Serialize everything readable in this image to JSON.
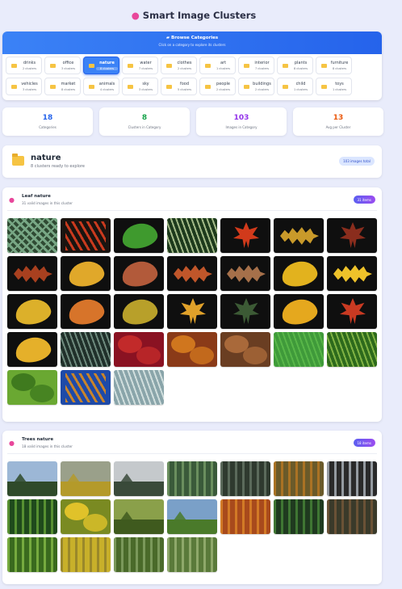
{
  "app": {
    "title": "Smart Image Clusters"
  },
  "browse": {
    "title": "Browse Categories",
    "subtitle": "Click on a category to explore its clusters",
    "row1": [
      {
        "name": "drinks",
        "count": "2 clusters"
      },
      {
        "name": "office",
        "count": "3 clusters"
      },
      {
        "name": "nature",
        "count": "8 clusters",
        "active": true
      },
      {
        "name": "water",
        "count": "7 clusters"
      },
      {
        "name": "clothes",
        "count": "2 clusters"
      },
      {
        "name": "art",
        "count": "1 clusters"
      },
      {
        "name": "interior",
        "count": "7 clusters"
      },
      {
        "name": "plants",
        "count": "8 clusters"
      },
      {
        "name": "furniture",
        "count": "8 clusters"
      }
    ],
    "row2": [
      {
        "name": "vehicles",
        "count": "3 clusters"
      },
      {
        "name": "market",
        "count": "8 clusters"
      },
      {
        "name": "animals",
        "count": "4 clusters"
      },
      {
        "name": "sky",
        "count": "3 clusters"
      },
      {
        "name": "food",
        "count": "5 clusters"
      },
      {
        "name": "people",
        "count": "2 clusters"
      },
      {
        "name": "buildings",
        "count": "2 clusters"
      },
      {
        "name": "child",
        "count": "1 clusters"
      },
      {
        "name": "toys",
        "count": "1 clusters"
      }
    ]
  },
  "stats": [
    {
      "value": "18",
      "label": "Categories",
      "color": "#2563eb"
    },
    {
      "value": "8",
      "label": "Clusters in Category",
      "color": "#16a34a"
    },
    {
      "value": "103",
      "label": "Images in Category",
      "color": "#9333ea"
    },
    {
      "value": "13",
      "label": "Avg per Cluster",
      "color": "#ea580c"
    }
  ],
  "category": {
    "name": "nature",
    "subtitle": "8 clusters ready to explore",
    "badge": "103 images total"
  },
  "clusters": [
    {
      "title": "Leaf nature",
      "subtitle": "31 valid images in this cluster",
      "pill": "31 items",
      "images": [
        {
          "bg": "#2f4a33",
          "fg": "#8bbf9a",
          "kind": "agave"
        },
        {
          "bg": "#1a1410",
          "fg": "#c93a1e",
          "kind": "tropical"
        },
        {
          "bg": "#0f0f0f",
          "fg": "#3f9a2e",
          "kind": "leaf"
        },
        {
          "bg": "#1d3a1c",
          "fg": "#b9cf9a",
          "kind": "stripe"
        },
        {
          "bg": "#0f0f0f",
          "fg": "#d13a1b",
          "kind": "maple"
        },
        {
          "bg": "#0f0f0f",
          "fg": "#c99a2a",
          "kind": "oak"
        },
        {
          "bg": "#0f0f0f",
          "fg": "#8a2d1d",
          "kind": "maple"
        },
        {
          "bg": "#0f0f0f",
          "fg": "#a8401f",
          "kind": "oak"
        },
        {
          "bg": "#0f0f0f",
          "fg": "#e0a82a",
          "kind": "leaf"
        },
        {
          "bg": "#0f0f0f",
          "fg": "#b25a3a",
          "kind": "leaf"
        },
        {
          "bg": "#0f0f0f",
          "fg": "#c0562a",
          "kind": "oak"
        },
        {
          "bg": "#0f0f0f",
          "fg": "#a6704a",
          "kind": "oak"
        },
        {
          "bg": "#0f0f0f",
          "fg": "#e2b21e",
          "kind": "leaf"
        },
        {
          "bg": "#0f0f0f",
          "fg": "#eec22a",
          "kind": "oak"
        },
        {
          "bg": "#0f0f0f",
          "fg": "#dcb02a",
          "kind": "leaf"
        },
        {
          "bg": "#0f0f0f",
          "fg": "#d7742a",
          "kind": "leaf"
        },
        {
          "bg": "#0f0f0f",
          "fg": "#b8a02a",
          "kind": "leaf"
        },
        {
          "bg": "#0f0f0f",
          "fg": "#e0a12a",
          "kind": "maple"
        },
        {
          "bg": "#0f0f0f",
          "fg": "#3c5a35",
          "kind": "maple"
        },
        {
          "bg": "#0f0f0f",
          "fg": "#e5a81e",
          "kind": "leaf"
        },
        {
          "bg": "#0f0f0f",
          "fg": "#c93a22",
          "kind": "maple"
        },
        {
          "bg": "#0f0f0f",
          "fg": "#e5b02a",
          "kind": "leaf"
        },
        {
          "bg": "#20302a",
          "fg": "#7c9a8c",
          "kind": "stripe"
        },
        {
          "bg": "#8a1222",
          "fg": "#c22a2a",
          "kind": "blob"
        },
        {
          "bg": "#8a3a18",
          "fg": "#d0761e",
          "kind": "blob"
        },
        {
          "bg": "#6a3e22",
          "fg": "#a9693a",
          "kind": "blob"
        },
        {
          "bg": "#3f9a3a",
          "fg": "#5cbb4a",
          "kind": "stripe"
        },
        {
          "bg": "#2d6a1c",
          "fg": "#8fbf4a",
          "kind": "stripe"
        },
        {
          "bg": "#6aa832",
          "fg": "#3f7a1e",
          "kind": "blob"
        },
        {
          "bg": "#1e4aa8",
          "fg": "#c9842a",
          "kind": "tropical"
        },
        {
          "bg": "#8aa5aa",
          "fg": "#dde8e6",
          "kind": "stripe"
        }
      ]
    },
    {
      "title": "Trees nature",
      "subtitle": "18 valid images in this cluster",
      "pill": "18 items",
      "images": [
        {
          "bg": "#9cb7d6",
          "fg": "#2f4a2a",
          "kind": "land"
        },
        {
          "bg": "#9aa08a",
          "fg": "#b49a2a",
          "kind": "land"
        },
        {
          "bg": "#c5c9cc",
          "fg": "#3a4a3a",
          "kind": "land"
        },
        {
          "bg": "#3a5a3a",
          "fg": "#7aa06a",
          "kind": "trees"
        },
        {
          "bg": "#2f3a2f",
          "fg": "#6a7a6a",
          "kind": "trees"
        },
        {
          "bg": "#6a5a2a",
          "fg": "#c07a22",
          "kind": "trees"
        },
        {
          "bg": "#2a2a2a",
          "fg": "#b8c0c8",
          "kind": "trees"
        },
        {
          "bg": "#1f4a1c",
          "fg": "#6aa83a",
          "kind": "trees"
        },
        {
          "bg": "#7a8a22",
          "fg": "#e0c22a",
          "kind": "blob"
        },
        {
          "bg": "#8aa04a",
          "fg": "#3f5a1e",
          "kind": "land"
        },
        {
          "bg": "#7aa0c8",
          "fg": "#4a7a2a",
          "kind": "land"
        },
        {
          "bg": "#a84a1c",
          "fg": "#e08a2a",
          "kind": "trees"
        },
        {
          "bg": "#1f3a1f",
          "fg": "#4a8a3a",
          "kind": "trees"
        },
        {
          "bg": "#3a3a2a",
          "fg": "#7a5a3a",
          "kind": "trees"
        },
        {
          "bg": "#3a6a1e",
          "fg": "#8ac04a",
          "kind": "trees"
        },
        {
          "bg": "#c8b02a",
          "fg": "#8a7a2a",
          "kind": "trees"
        },
        {
          "bg": "#4a6a2a",
          "fg": "#8aa86a",
          "kind": "trees"
        },
        {
          "bg": "#5a7a3a",
          "fg": "#a0b87a",
          "kind": "trees"
        }
      ]
    }
  ]
}
